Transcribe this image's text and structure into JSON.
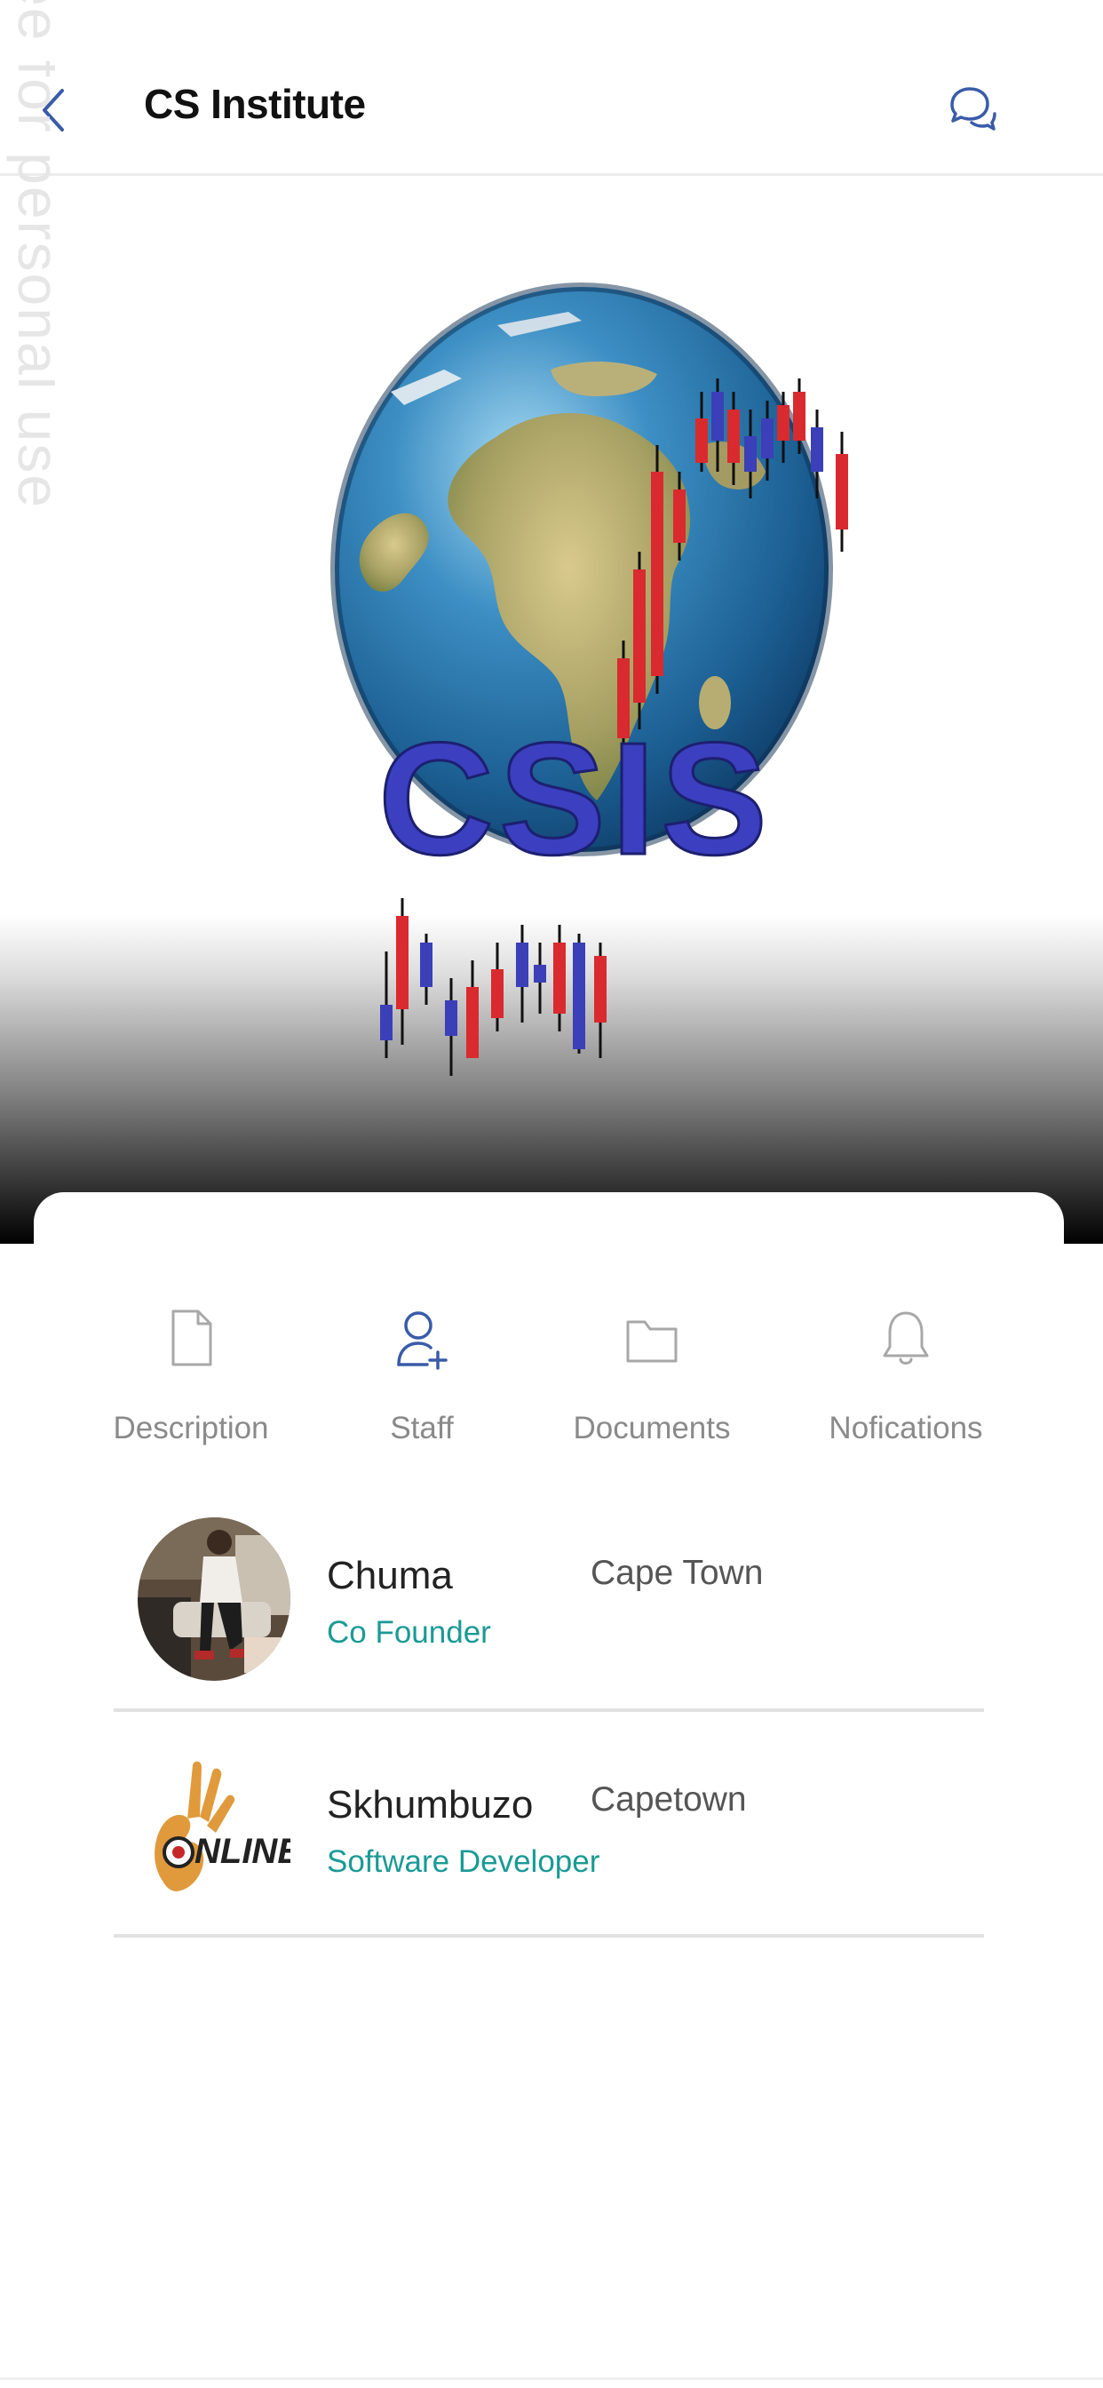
{
  "header": {
    "title": "CS Institute",
    "back_icon": "chevron-left-icon",
    "chat_icon": "chat-bubbles-icon"
  },
  "watermark": {
    "text": "ee for personal use"
  },
  "hero": {
    "logo_text": "CSIS"
  },
  "tabs": [
    {
      "label": "Description",
      "icon": "document-icon",
      "active": false
    },
    {
      "label": "Staff",
      "icon": "add-user-icon",
      "active": true
    },
    {
      "label": "Documents",
      "icon": "folder-icon",
      "active": false
    },
    {
      "label": "Nofications",
      "icon": "bell-icon",
      "active": false
    }
  ],
  "staff": [
    {
      "name": "Chuma",
      "role": "Co Founder",
      "city": "Cape Town"
    },
    {
      "name": "Skhumbuzo",
      "role": "Software Developer",
      "city": "Capetown",
      "avatar_text": "NLINE"
    }
  ],
  "colors": {
    "accent": "#3a5ba9",
    "role": "#1a9a95",
    "tab_label": "#8a8a8a"
  }
}
